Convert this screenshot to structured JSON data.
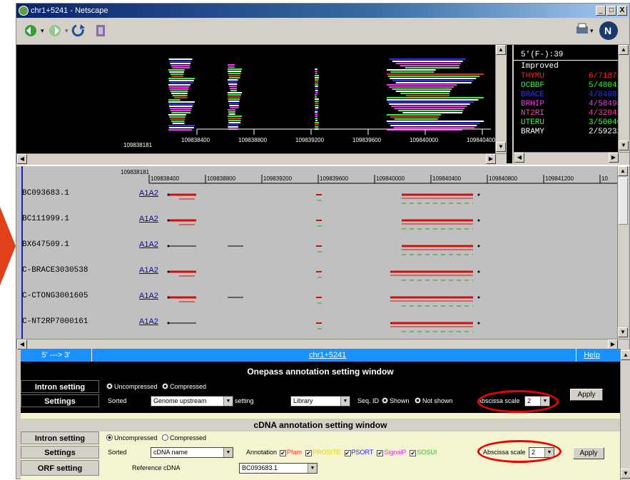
{
  "window": {
    "title": "chr1+5241 - Netscape",
    "min": "_",
    "max": "□",
    "close": "X"
  },
  "overview": {
    "start_label": "109838181",
    "ticks": [
      "109838400",
      "109838800",
      "109839200",
      "109839600",
      "109840000",
      "109840400"
    ]
  },
  "library_panel": {
    "header": "5'(F-):39",
    "subheader": "Improved",
    "items": [
      {
        "name": "THYMU",
        "value": "6/71874",
        "color": "#ff2020"
      },
      {
        "name": "OCBBF",
        "value": "5/48042",
        "color": "#20ff20"
      },
      {
        "name": "BRACE",
        "value": "4/84087",
        "color": "#3030ff"
      },
      {
        "name": "BRHIP",
        "value": "4/58498",
        "color": "#ff30ff"
      },
      {
        "name": "NT2RI",
        "value": "4/32042",
        "color": "#ff40a0"
      },
      {
        "name": "UTERU",
        "value": "3/50040",
        "color": "#40ff40"
      },
      {
        "name": "BRAMY",
        "value": "2/59232",
        "color": "#ffffff"
      }
    ]
  },
  "detail": {
    "start_label": "109838181",
    "ticks": [
      "109838400",
      "109838800",
      "109839200",
      "109839600",
      "109840000",
      "109840400",
      "109840800",
      "109841200",
      "10"
    ],
    "rows": [
      {
        "label": "BC093683.1",
        "link": "A1A2"
      },
      {
        "label": "BC111999.1",
        "link": "A1A2"
      },
      {
        "label": "BX647509.1",
        "link": "A1A2"
      },
      {
        "label": "C-BRACE3030538",
        "link": "A1A2"
      },
      {
        "label": "C-CTONG3001605",
        "link": "A1A2"
      },
      {
        "label": "C-NT2RP7000161",
        "link": "A1A2"
      }
    ]
  },
  "settings": {
    "direction": "5' ---> 3'",
    "location_link": "chr1+5241",
    "help": "Help",
    "onepass": {
      "title": "Onepass annotation setting window",
      "intron_label": "Intron setting",
      "intron_opts": [
        "Uncompressed",
        "Compressed"
      ],
      "settings_label": "Settings",
      "sorted_label": "Sorted",
      "sorted_value": "Genome upstream",
      "color_label": "Color setting",
      "color_value": "Library",
      "seqid_label": "Seq. ID",
      "seqid_opts": [
        "Shown",
        "Not shown"
      ],
      "abscissa_label": "Abscissa scale",
      "abscissa_value": "2",
      "apply": "Apply"
    },
    "cdna": {
      "title": "cDNA annotation setting window",
      "intron_label": "Intron setting",
      "intron_opts": [
        "Uncompressed",
        "Compressed"
      ],
      "settings_label": "Settings",
      "sorted_label": "Sorted",
      "sorted_value": "cDNA name",
      "annotation_label": "Annotation",
      "annotations": [
        {
          "name": "Pfam",
          "color": "#ff3030"
        },
        {
          "name": "PROSITE",
          "color": "#e8d000"
        },
        {
          "name": "PSORT",
          "color": "#2020ff"
        },
        {
          "name": "SignalP",
          "color": "#e030e0"
        },
        {
          "name": "SOSUI",
          "color": "#30c030"
        }
      ],
      "abscissa_label": "Abscissa scale",
      "abscissa_value": "2",
      "apply": "Apply",
      "orf_label": "ORF setting",
      "ref_label": "Reference cDNA",
      "ref_value": "BC093683.1"
    }
  }
}
